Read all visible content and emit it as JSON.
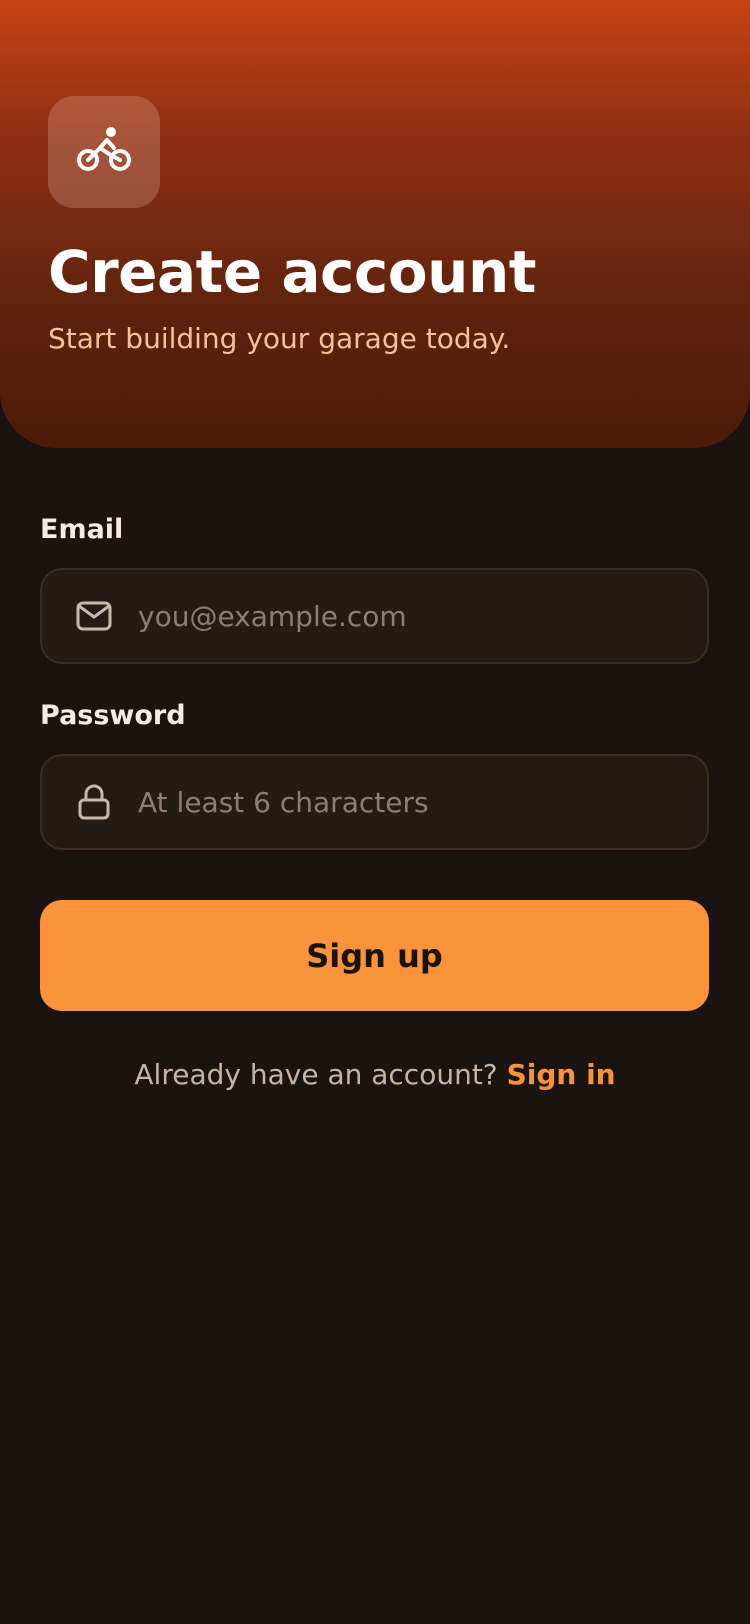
{
  "header": {
    "title": "Create account",
    "subtitle": "Start building your garage today.",
    "logo_icon": "bicycle-icon"
  },
  "form": {
    "email": {
      "label": "Email",
      "placeholder": "you@example.com",
      "value": "",
      "icon": "mail-icon"
    },
    "password": {
      "label": "Password",
      "placeholder": "At least 6 characters",
      "value": "",
      "icon": "lock-icon"
    },
    "submit_label": "Sign up"
  },
  "footer": {
    "prompt": "Already have an account?",
    "link_label": "Sign in"
  },
  "colors": {
    "accent": "#fb923c",
    "background": "#1a1310",
    "hero_top": "#c64313",
    "hero_bottom": "#4b1c09",
    "field_background": "#241b15"
  }
}
